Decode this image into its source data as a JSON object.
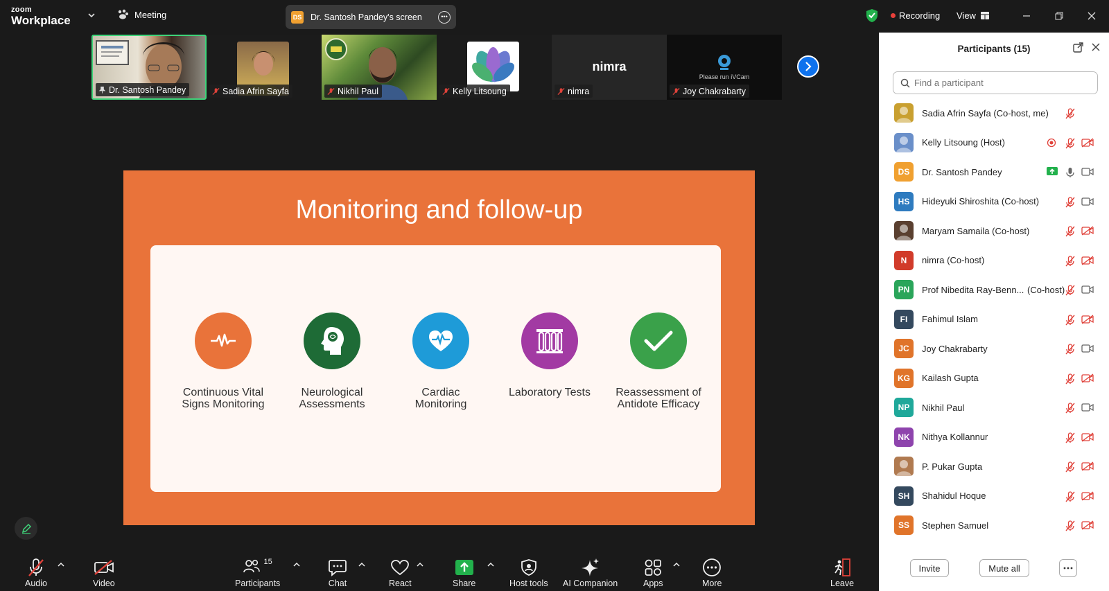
{
  "app": {
    "brand_small": "zoom",
    "brand_large": "Workplace",
    "meeting_label": "Meeting",
    "screen_share_badge": "DS",
    "screen_share_label": "Dr. Santosh Pandey's screen",
    "recording_label": "Recording",
    "view_label": "View"
  },
  "thumbnails": [
    {
      "name": "Dr. Santosh Pandey",
      "icon": "pin-icon",
      "active": true
    },
    {
      "name": "Sadia Afrin Sayfa",
      "icon": "mic-off-icon"
    },
    {
      "name": "Nikhil Paul",
      "icon": "mic-off-icon"
    },
    {
      "name": "Kelly Litsoung",
      "icon": "mic-off-icon"
    },
    {
      "name": "nimra",
      "icon": "mic-off-icon",
      "big_label": "nimra"
    },
    {
      "name": "Joy Chakrabarty",
      "icon": "mic-off-icon",
      "note": "Please run iVCam"
    }
  ],
  "slide": {
    "title": "Monitoring and follow-up",
    "items": [
      {
        "label_line1": "Continuous Vital",
        "label_line2": "Signs Monitoring",
        "color": "#e9733a",
        "icon": "pulse-icon"
      },
      {
        "label_line1": "Neurological",
        "label_line2": "Assessments",
        "color": "#1e6b36",
        "icon": "brain-head-icon"
      },
      {
        "label_line1": "Cardiac",
        "label_line2": "Monitoring",
        "color": "#1e9bd8",
        "icon": "heart-pulse-icon"
      },
      {
        "label_line1": "Laboratory Tests",
        "label_line2": "",
        "color": "#a23aa3",
        "icon": "test-tubes-icon"
      },
      {
        "label_line1": "Reassessment of",
        "label_line2": "Antidote Efficacy",
        "color": "#3aa14a",
        "icon": "checkmark-icon"
      }
    ]
  },
  "toolbar": {
    "audio": "Audio",
    "video": "Video",
    "participants": "Participants",
    "participants_count": "15",
    "chat": "Chat",
    "react": "React",
    "share": "Share",
    "host_tools": "Host tools",
    "ai_companion": "AI Companion",
    "apps": "Apps",
    "more": "More",
    "leave": "Leave"
  },
  "participants_panel": {
    "title": "Participants (15)",
    "search_placeholder": "Find a participant",
    "invite_label": "Invite",
    "mute_all_label": "Mute all",
    "people": [
      {
        "name": "Sadia Afrin Sayfa (Co-host, me)",
        "initials": "",
        "color": "#c9a030",
        "photo": true,
        "mic": "off",
        "video": "none"
      },
      {
        "name": "Kelly Litsoung (Host)",
        "initials": "",
        "color": "#6a8fc9",
        "photo": true,
        "mic": "off",
        "video": "off",
        "recording": true
      },
      {
        "name": "Dr. Santosh Pandey",
        "initials": "DS",
        "color": "#f0a030",
        "mic": "on",
        "video": "on",
        "sharing": true
      },
      {
        "name": "Hideyuki Shiroshita (Co-host)",
        "initials": "HS",
        "color": "#2e7bbf",
        "mic": "off",
        "video": "on"
      },
      {
        "name": "Maryam Samaila (Co-host)",
        "initials": "",
        "color": "#5a4030",
        "photo": true,
        "mic": "off",
        "video": "off"
      },
      {
        "name": "nimra (Co-host)",
        "initials": "N",
        "color": "#d13b2a",
        "mic": "off",
        "video": "off"
      },
      {
        "name": "Prof Nibedita Ray-Benn...",
        "suffix": "(Co-host)",
        "initials": "PN",
        "color": "#2aa55a",
        "mic": "off",
        "video": "on"
      },
      {
        "name": "Fahimul Islam",
        "initials": "FI",
        "color": "#34495e",
        "mic": "off",
        "video": "off"
      },
      {
        "name": "Joy Chakrabarty",
        "initials": "JC",
        "color": "#e0742a",
        "mic": "off",
        "video": "on"
      },
      {
        "name": "Kailash Gupta",
        "initials": "KG",
        "color": "#e0742a",
        "mic": "off",
        "video": "off"
      },
      {
        "name": "Nikhil Paul",
        "initials": "NP",
        "color": "#1fa89a",
        "mic": "off",
        "video": "on"
      },
      {
        "name": "Nithya Kollannur",
        "initials": "NK",
        "color": "#8e44ad",
        "mic": "off",
        "video": "off"
      },
      {
        "name": "P. Pukar Gupta",
        "initials": "",
        "color": "#b07a50",
        "photo": true,
        "mic": "off",
        "video": "off"
      },
      {
        "name": "Shahidul Hoque",
        "initials": "SH",
        "color": "#34495e",
        "mic": "off",
        "video": "off"
      },
      {
        "name": "Stephen Samuel",
        "initials": "SS",
        "color": "#e0742a",
        "mic": "off",
        "video": "off"
      }
    ]
  }
}
